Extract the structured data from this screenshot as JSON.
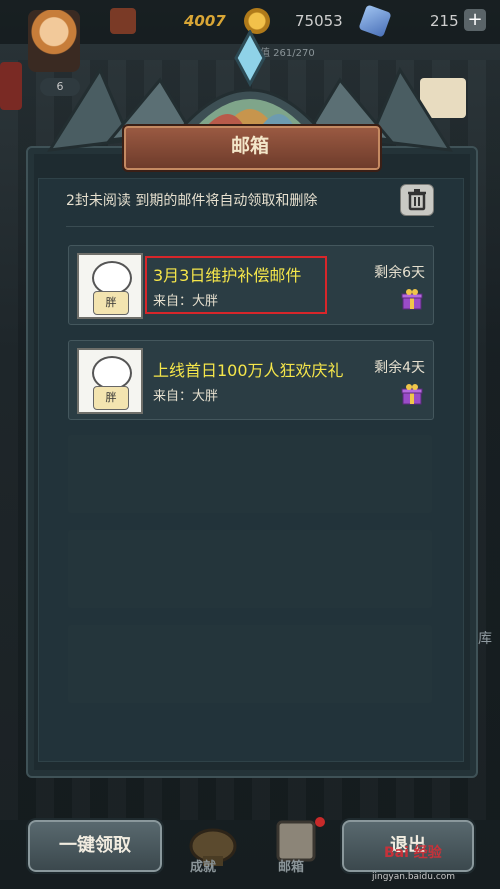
{
  "hud": {
    "gold": "4007",
    "coins": "75053",
    "gems": "215",
    "plus_label": "+",
    "energy_text": "精力值 261/270",
    "level": "6"
  },
  "mailbox": {
    "title": "邮箱",
    "info_text": "2封未阅读  到期的邮件将自动领取和删除",
    "mails": [
      {
        "title": "3月3日维护补偿邮件",
        "from": "来自：大胖",
        "remaining": "剩余6天",
        "thumb_text": "胖"
      },
      {
        "title": "上线首日100万人狂欢庆礼",
        "from": "来自：大胖",
        "remaining": "剩余4天",
        "thumb_text": "胖"
      }
    ]
  },
  "footer": {
    "collect_all_label": "一键领取",
    "exit_label": "退出",
    "nav": {
      "achievements_label": "成就",
      "mailbox_label": "邮箱"
    }
  },
  "side": {
    "right_label": "库"
  },
  "watermark": {
    "brand": "Bai 经验",
    "url": "jingyan.baidu.com"
  },
  "colors": {
    "mail_title": "#f5e64a",
    "highlight": "#d8262a",
    "plaque": "#8a4a36"
  }
}
